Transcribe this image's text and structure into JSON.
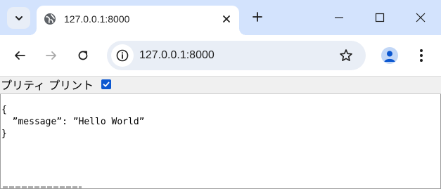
{
  "window": {
    "tab": {
      "title": "127.0.0.1:8000"
    }
  },
  "address_bar": {
    "url": "127.0.0.1:8000"
  },
  "prettyprint": {
    "label": "プリティ プリント",
    "checked": true
  },
  "json_view": {
    "open_brace": "{",
    "line": "  ”message”: ”Hello World”",
    "close_brace": "}"
  },
  "colors": {
    "titlebar": "#d3e3fd",
    "omnibox": "#e9eef6",
    "checkbox": "#0b57d0"
  },
  "icons": [
    "tab-search-icon",
    "globe-icon",
    "close-icon",
    "plus-icon",
    "minimize-icon",
    "maximize-icon",
    "close-window-icon",
    "back-arrow-icon",
    "forward-arrow-icon",
    "reload-icon",
    "info-icon",
    "star-icon",
    "profile-icon",
    "kebab-menu-icon",
    "checkmark-icon"
  ]
}
